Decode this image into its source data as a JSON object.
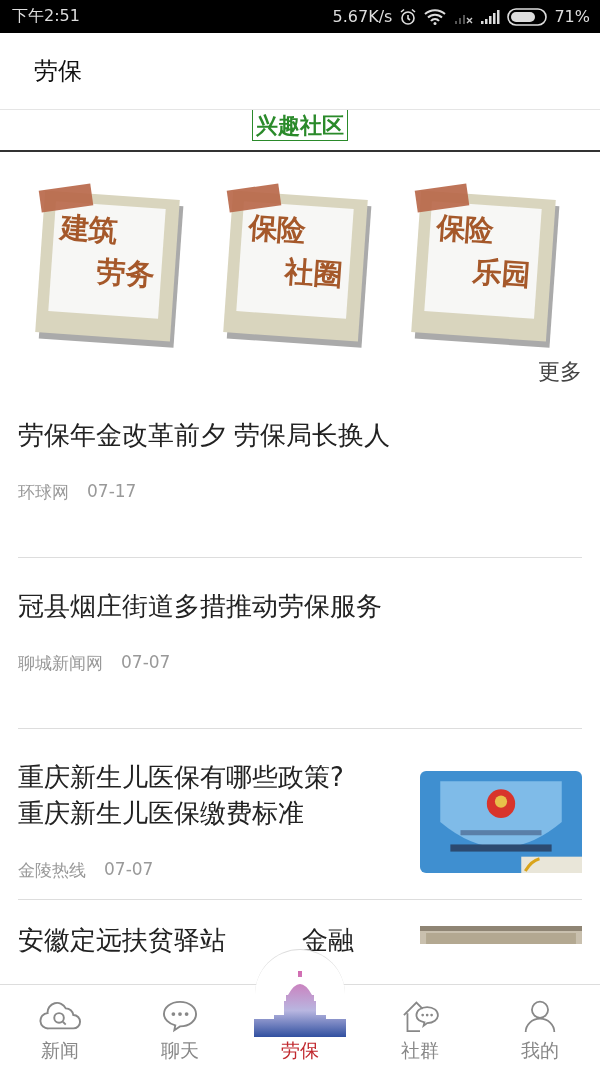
{
  "status_bar": {
    "time": "下午2:51",
    "speed": "5.67K/s",
    "battery": "71%"
  },
  "header": {
    "title": "劳保"
  },
  "banner": {
    "text": "兴趣社区"
  },
  "cards": [
    {
      "line1": "建筑",
      "line2": "劳务"
    },
    {
      "line1": "保险",
      "line2": "社圈"
    },
    {
      "line1": "保险",
      "line2": "乐园"
    }
  ],
  "more": "更多",
  "articles": [
    {
      "title": "劳保年金改革前夕 劳保局长换人",
      "source": "环球网",
      "date": "07-17"
    },
    {
      "title": "冠县烟庄街道多措推动劳保服务",
      "source": "聊城新闻网",
      "date": "07-07"
    },
    {
      "title": "重庆新生儿医保有哪些政策?\n重庆新生儿医保缴费标准",
      "source": "金陵热线",
      "date": "07-07"
    },
    {
      "title": "安徽定远扶贫驿站",
      "title_end": "金融"
    }
  ],
  "nav": [
    {
      "label": "新闻",
      "selected": false
    },
    {
      "label": "聊天",
      "selected": false
    },
    {
      "label": "劳保",
      "selected": true
    },
    {
      "label": "社群",
      "selected": false
    },
    {
      "label": "我的",
      "selected": false
    }
  ]
}
